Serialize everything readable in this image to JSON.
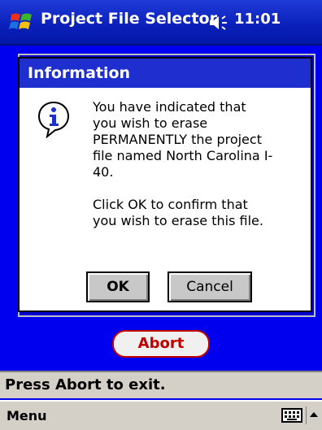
{
  "title_bar": {
    "title": "Project File Selector",
    "time": "11:01",
    "start_icon": "windows-flag-icon",
    "speaker_icon": "speaker-icon"
  },
  "dialog": {
    "title": "Information",
    "icon": "info-icon",
    "message_lines": [
      "You have indicated that",
      "you wish to erase",
      "PERMANENTLY the project",
      "file named North Carolina I-",
      "40.",
      "",
      "Click OK to confirm that",
      "you wish to erase this file."
    ],
    "ok_label": "OK",
    "cancel_label": "Cancel"
  },
  "abort_label": "Abort",
  "status": "Press Abort to exit.",
  "menu": {
    "label": "Menu",
    "keyboard_icon": "keyboard-icon",
    "sip_icon": "up-arrow-icon"
  },
  "colors": {
    "background": "#0000ee",
    "titlebar": "#0a1fb8",
    "dialog_title": "#1f2fcf",
    "abort_text": "#c00000"
  }
}
